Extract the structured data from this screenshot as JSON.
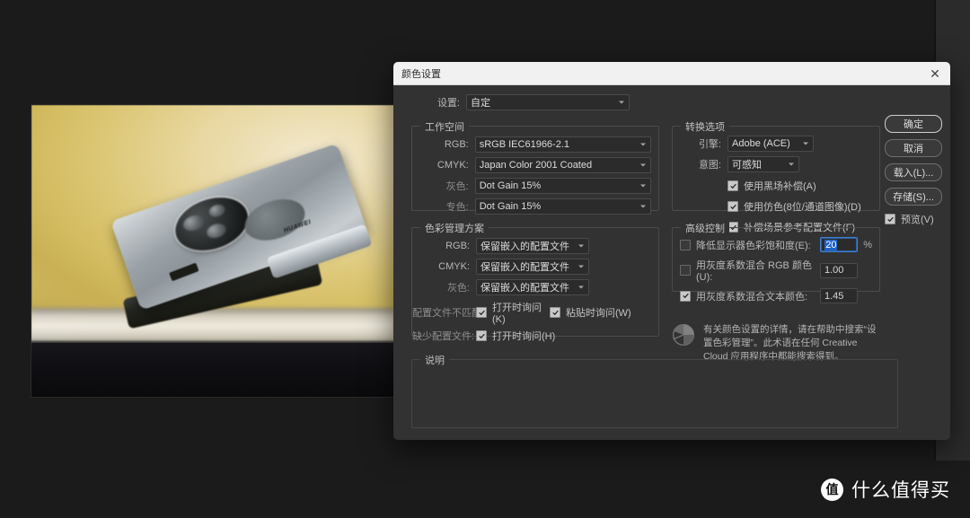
{
  "dialog": {
    "title": "颜色设置",
    "close_icon": "close-icon",
    "settings": {
      "label": "设置:",
      "value": "自定"
    },
    "workspace": {
      "title": "工作空间",
      "rows": [
        {
          "label": "RGB:",
          "value": "sRGB IEC61966-2.1"
        },
        {
          "label": "CMYK:",
          "value": "Japan Color 2001 Coated"
        },
        {
          "label": "灰色:",
          "value": "Dot Gain 15%"
        },
        {
          "label": "专色:",
          "value": "Dot Gain 15%"
        }
      ]
    },
    "policies": {
      "title": "色彩管理方案",
      "rows": [
        {
          "label": "RGB:",
          "value": "保留嵌入的配置文件"
        },
        {
          "label": "CMYK:",
          "value": "保留嵌入的配置文件"
        },
        {
          "label": "灰色:",
          "value": "保留嵌入的配置文件"
        }
      ],
      "mismatch_label": "配置文件不匹配:",
      "mismatch_open": {
        "label": "打开时询问(K)",
        "checked": true
      },
      "mismatch_paste": {
        "label": "粘贴时询问(W)",
        "checked": true
      },
      "missing_label": "缺少配置文件:",
      "missing_open": {
        "label": "打开时询问(H)",
        "checked": true
      }
    },
    "conversion": {
      "title": "转换选项",
      "engine": {
        "label": "引擎:",
        "value": "Adobe (ACE)"
      },
      "intent": {
        "label": "意图:",
        "value": "可感知"
      },
      "checks": [
        {
          "label": "使用黑场补偿(A)",
          "checked": true
        },
        {
          "label": "使用仿色(8位/通道图像)(D)",
          "checked": true
        },
        {
          "label": "补偿场景参考配置文件(F)",
          "checked": true
        }
      ]
    },
    "advanced": {
      "title": "高级控制",
      "desaturate": {
        "label": "降低显示器色彩饱和度(E):",
        "checked": false,
        "value": "20",
        "unit": "%"
      },
      "blend_rgb": {
        "label": "用灰度系数混合 RGB 颜色(U):",
        "checked": false,
        "value": "1.00"
      },
      "blend_text": {
        "label": "用灰度系数混合文本颜色:",
        "checked": true,
        "value": "1.45"
      },
      "note_icon": "color-wheel-icon",
      "note": "有关颜色设置的详情，请在帮助中搜索“设置色彩管理”。此术语在任何 Creative Cloud 应用程序中都能搜索得到。"
    },
    "description": {
      "title": "说明",
      "text": ""
    },
    "buttons": [
      {
        "label": "确定",
        "name": "ok-button",
        "primary": true
      },
      {
        "label": "取消",
        "name": "cancel-button",
        "primary": false
      },
      {
        "label": "载入(L)...",
        "name": "load-button",
        "primary": false
      },
      {
        "label": "存储(S)...",
        "name": "save-button",
        "primary": false
      }
    ],
    "preview": {
      "label": "预览(V)",
      "checked": true
    }
  },
  "photo": {
    "brand": "HUAWEI"
  },
  "watermark": {
    "logo": "值",
    "text": "什么值得买"
  },
  "colors": {
    "dialog_bg": "#323232",
    "titlebar_bg": "#f1f1f1",
    "field_bg": "#2b2b2b",
    "accent_blue": "#1f64c8",
    "app_bg": "#1b1b1b"
  }
}
